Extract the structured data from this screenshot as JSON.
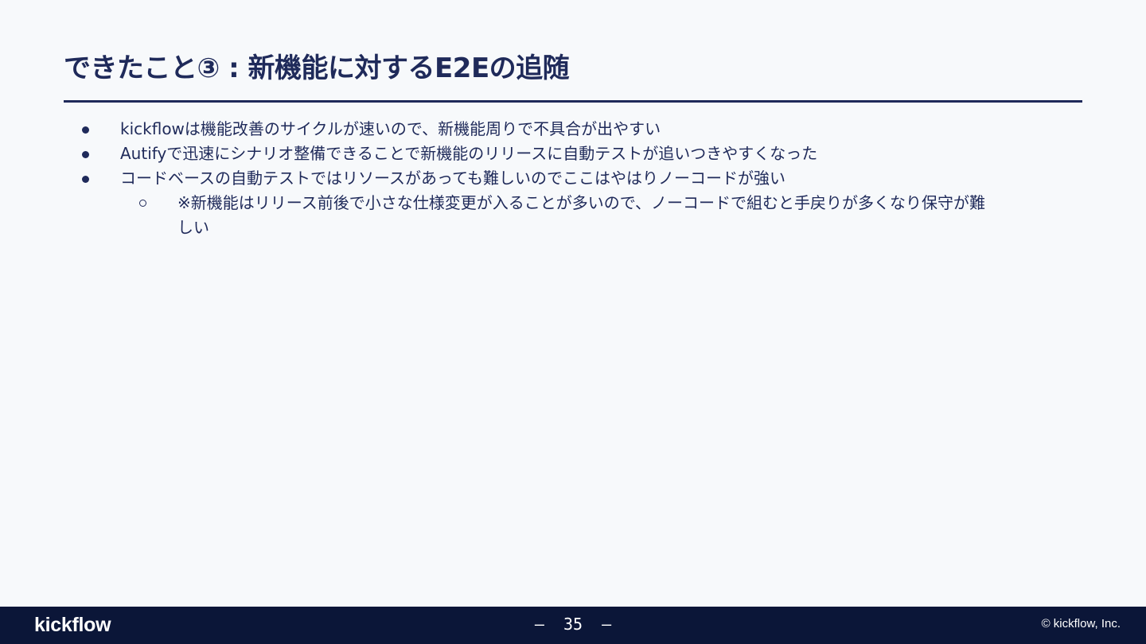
{
  "slide": {
    "title": "できたこと③ : 新機能に対するE2Eの追随",
    "bullets": [
      "kickflowは機能改善のサイクルが速いので、新機能周りで不具合が出やすい",
      "Autifyで迅速にシナリオ整備できることで新機能のリリースに自動テストが追いつきやすくなった",
      "コードベースの自動テストではリソースがあっても難しいのでここはやはりノーコードが強い"
    ],
    "sub_bullets": [
      "※新機能はリリース前後で小さな仕様変更が入ることが多いので、ノーコードで組むと手戻りが多くなり保守が難しい"
    ]
  },
  "footer": {
    "logo": "kickflow",
    "page_number": "–  35  –",
    "copyright": "© kickflow, Inc."
  },
  "colors": {
    "background": "#f7f9fb",
    "text": "#1f2a5a",
    "footer_bg": "#0b1638",
    "footer_text": "#ffffff"
  }
}
